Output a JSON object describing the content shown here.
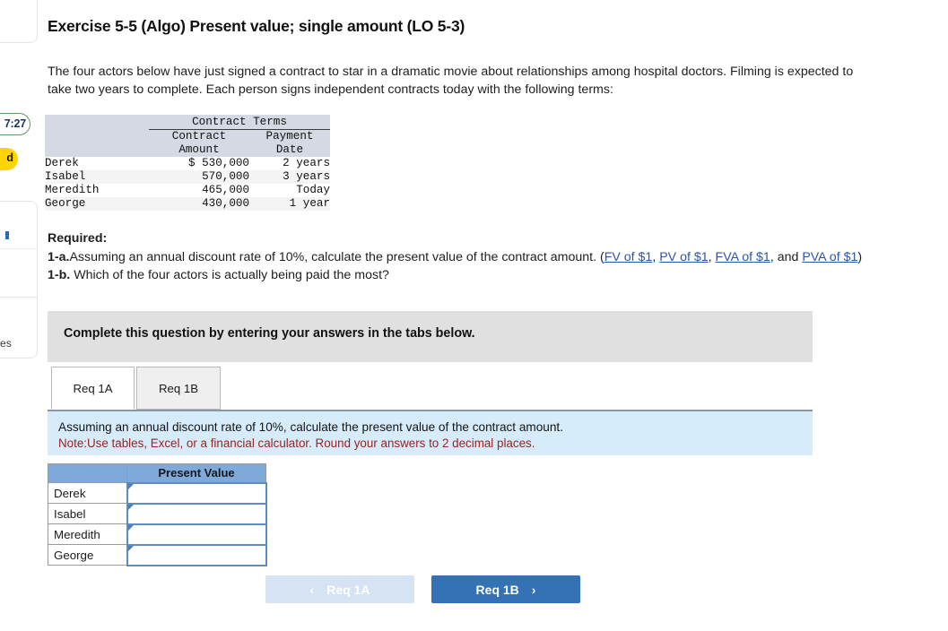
{
  "page": {
    "title": "Exercise 5-5 (Algo) Present value; single amount (LO 5-3)",
    "intro": "The four actors below have just signed a contract to star in a dramatic movie about relationships among hospital doctors. Filming is expected to take two years to complete. Each person signs independent contracts today with the following terms:"
  },
  "contract_table": {
    "group_header": "Contract Terms",
    "col_amount_line1": "Contract",
    "col_amount_line2": "Amount",
    "col_date_line1": "Payment",
    "col_date_line2": "Date",
    "rows": [
      {
        "name": "Derek",
        "amount": "$ 530,000",
        "date": "2 years"
      },
      {
        "name": "Isabel",
        "amount": "570,000",
        "date": "3 years"
      },
      {
        "name": "Meredith",
        "amount": "465,000",
        "date": "Today"
      },
      {
        "name": "George",
        "amount": "430,000",
        "date": "1 year"
      }
    ]
  },
  "required": {
    "heading": "Required:",
    "item_1a_label": "1-a.",
    "item_1a_text": "Assuming an annual discount rate of 10%, calculate the present value of the contract amount. (",
    "links": [
      {
        "label": "FV of $1"
      },
      {
        "label": "PV of $1"
      },
      {
        "label": "FVA of $1"
      },
      {
        "label": "PVA of $1"
      }
    ],
    "link_sep": ", ",
    "link_and": ", and ",
    "link_close": ")",
    "item_1b_label": "1-b.",
    "item_1b_text": "Which of the four actors is actually being paid the most?"
  },
  "instruction_bar": {
    "text": "Complete this question by entering your answers in the tabs below."
  },
  "tabs": [
    {
      "label": "Req 1A",
      "active": true
    },
    {
      "label": "Req 1B",
      "active": false
    }
  ],
  "info_panel": {
    "line1": "Assuming an annual discount rate of 10%, calculate the present value of the contract amount.",
    "line2": "Note:Use tables, Excel, or a financial calculator. Round your answers to 2 decimal places.",
    "note_color": "#a02020",
    "background": "#d7ecfa"
  },
  "answer_table": {
    "header_blank": "",
    "header_value": "Present Value",
    "header_background": "#7fa9d8",
    "rows": [
      {
        "name": "Derek",
        "value": "",
        "placeholder": ""
      },
      {
        "name": "Isabel",
        "value": "",
        "placeholder": ""
      },
      {
        "name": "Meredith",
        "value": "",
        "placeholder": ""
      },
      {
        "name": "George",
        "value": "",
        "placeholder": ""
      }
    ]
  },
  "nav": {
    "prev_label": "Req 1A",
    "prev_chevron": "‹",
    "prev_color": "#d5e3f2",
    "next_label": "Req 1B",
    "next_chevron": "›",
    "next_color": "#3472b5"
  },
  "left_strip": {
    "timer": "7:27",
    "timer_border_color": "#5b9c5b",
    "badge": "d",
    "badge_color": "#ffd400",
    "fragment_text": "es"
  }
}
